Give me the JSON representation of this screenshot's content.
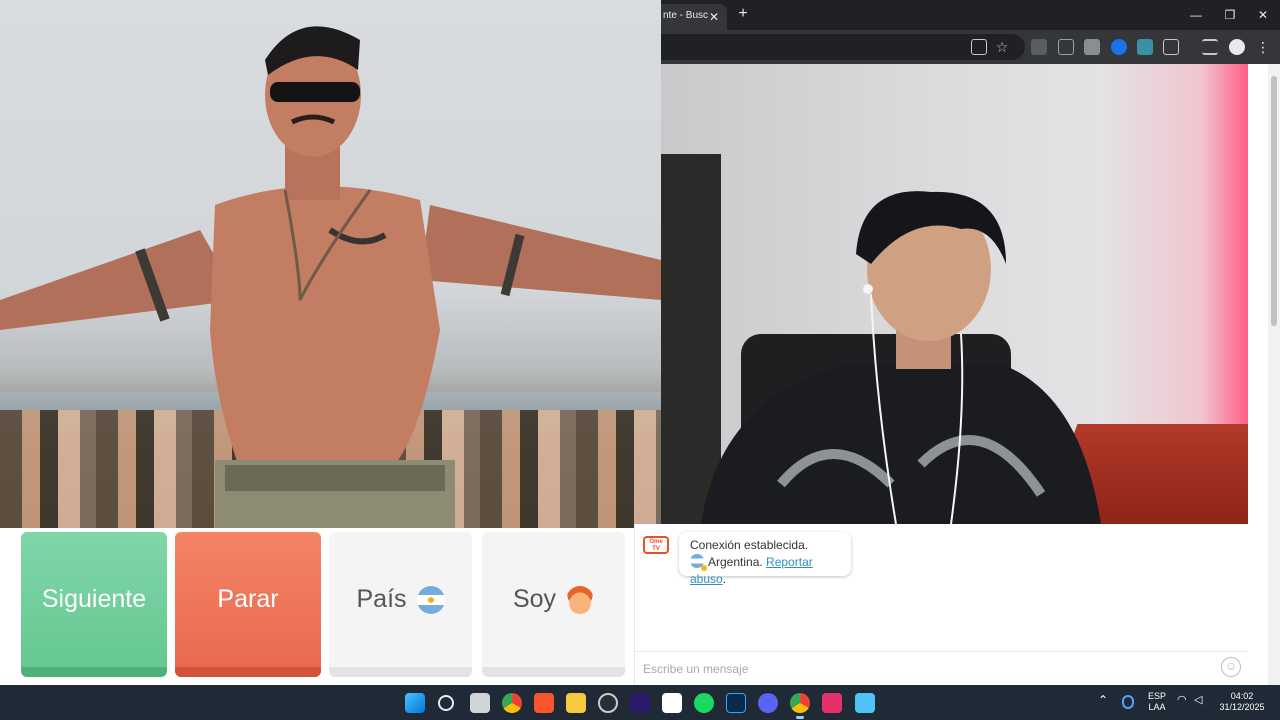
{
  "browser": {
    "tab_title": "nte - Busc",
    "tab_close": "✕",
    "new_tab": "+",
    "window_minimize": "—",
    "window_maximize": "❐",
    "window_close": "✕"
  },
  "controls": {
    "next_label": "Siguiente",
    "stop_label": "Parar",
    "country_label": "País",
    "country_icon": "argentina-flag-icon",
    "gender_label": "Soy",
    "gender_icon": "boy-emoji-icon"
  },
  "chat": {
    "logo_line1": "Ome",
    "logo_line2": "TV",
    "status_text": "Conexión establecida.",
    "country_name": "Argentina.",
    "report_link": "Reportar abuso",
    "report_suffix": ".",
    "input_placeholder": "Escribe un mensaje",
    "emoji_button_icon": "smiley-icon"
  },
  "taskbar": {
    "apps": [
      "windows-start-icon",
      "search-icon",
      "task-view-icon",
      "chrome-icon",
      "brave-icon",
      "file-explorer-icon",
      "steam-icon",
      "premiere-icon",
      "capcut-icon",
      "spotify-icon",
      "photoshop-icon",
      "discord-icon",
      "chrome-active-icon",
      "tiktok-icon",
      "notepad-icon"
    ],
    "language_line1": "ESP",
    "language_line2": "LAA",
    "time": "04:02",
    "date": "31/12/2025"
  },
  "colors": {
    "next_green": "#6fcf97",
    "stop_red": "#ee7457",
    "link_blue": "#2f8fbd",
    "omegle_orange": "#e94f2c",
    "taskbar_bg": "#1f2a36"
  }
}
